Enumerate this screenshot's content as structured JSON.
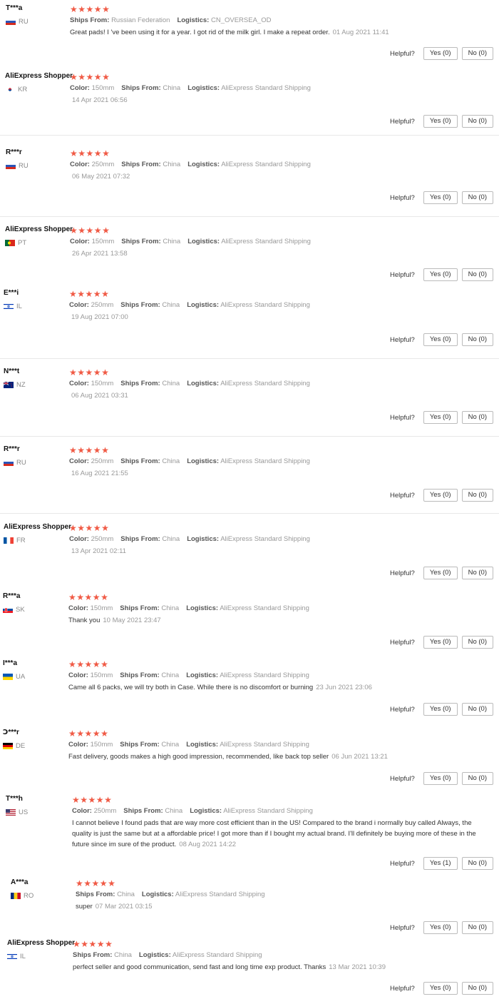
{
  "labels": {
    "color": "Color:",
    "ships_from": "Ships From:",
    "logistics": "Logistics:",
    "helpful": "Helpful?"
  },
  "reviews": [
    {
      "name": "T***a",
      "country": "RU",
      "flag": "ru",
      "rating": 5,
      "ships_from": "Russian Federation",
      "logistics": "CN_OVERSEA_OD",
      "text": "Great pads! I 've been using it for a year. I got rid of the milk girl. I make a repeat order.",
      "date": "01 Aug 2021 11:41",
      "yes": "Yes (0)",
      "no": "No (0)"
    },
    {
      "name": "AliExpress Shopper",
      "country": "KR",
      "flag": "kr",
      "rating": 5,
      "color": "150mm",
      "ships_from": "China",
      "logistics": "AliExpress Standard Shipping",
      "date": "14 Apr 2021 06:56",
      "yes": "Yes (0)",
      "no": "No (0)"
    },
    {
      "name": "R***r",
      "country": "RU",
      "flag": "ru",
      "rating": 5,
      "color": "250mm",
      "ships_from": "China",
      "logistics": "AliExpress Standard Shipping",
      "date": "06 May 2021 07:32",
      "yes": "Yes (0)",
      "no": "No (0)"
    },
    {
      "name": "AliExpress Shopper",
      "country": "PT",
      "flag": "pt",
      "rating": 5,
      "color": "150mm",
      "ships_from": "China",
      "logistics": "AliExpress Standard Shipping",
      "date": "26 Apr 2021 13:58",
      "yes": "Yes (0)",
      "no": "No (0)"
    },
    {
      "name": "E***i",
      "country": "IL",
      "flag": "il",
      "rating": 5,
      "color": "250mm",
      "ships_from": "China",
      "logistics": "AliExpress Standard Shipping",
      "date": "19 Aug 2021 07:00",
      "yes": "Yes (0)",
      "no": "No (0)"
    },
    {
      "name": "N***t",
      "country": "NZ",
      "flag": "nz",
      "rating": 5,
      "color": "150mm",
      "ships_from": "China",
      "logistics": "AliExpress Standard Shipping",
      "date": "06 Aug 2021 03:31",
      "yes": "Yes (0)",
      "no": "No (0)"
    },
    {
      "name": "R***r",
      "country": "RU",
      "flag": "ru",
      "rating": 5,
      "color": "250mm",
      "ships_from": "China",
      "logistics": "AliExpress Standard Shipping",
      "date": "16 Aug 2021 21:55",
      "yes": "Yes (0)",
      "no": "No (0)"
    },
    {
      "name": "AliExpress Shopper",
      "country": "FR",
      "flag": "fr",
      "rating": 5,
      "color": "250mm",
      "ships_from": "China",
      "logistics": "AliExpress Standard Shipping",
      "date": "13 Apr 2021 02:11",
      "yes": "Yes (0)",
      "no": "No (0)"
    },
    {
      "name": "R***a",
      "country": "SK",
      "flag": "sk",
      "rating": 5,
      "color": "150mm",
      "ships_from": "China",
      "logistics": "AliExpress Standard Shipping",
      "text": "Thank you",
      "date": "10 May 2021 23:47",
      "yes": "Yes (0)",
      "no": "No (0)"
    },
    {
      "name": "I***a",
      "country": "UA",
      "flag": "ua",
      "rating": 5,
      "color": "150mm",
      "ships_from": "China",
      "logistics": "AliExpress Standard Shipping",
      "text": "Came all 6 packs, we will try both in Case. While there is no discomfort or burning",
      "date": "23 Jun 2021 23:06",
      "yes": "Yes (0)",
      "no": "No (0)"
    },
    {
      "name": "Ↄ***r",
      "country": "DE",
      "flag": "de",
      "rating": 5,
      "color": "150mm",
      "ships_from": "China",
      "logistics": "AliExpress Standard Shipping",
      "text": "Fast delivery, goods makes a high good impression, recommended, like back top seller",
      "date": "06 Jun 2021 13:21",
      "yes": "Yes (0)",
      "no": "No (0)"
    },
    {
      "name": "T***h",
      "country": "US",
      "flag": "us",
      "rating": 5,
      "color": "250mm",
      "ships_from": "China",
      "logistics": "AliExpress Standard Shipping",
      "text": "I cannot believe I found pads that are way more cost efficient than in the US! Compared to the brand i normally buy called Always, the quality is just the same but at a affordable price! I got more than if I bought my actual brand. I'll definitely be buying more of these in the future since im sure of the product.",
      "date": "08 Aug 2021 14:22",
      "yes": "Yes (1)",
      "no": "No (0)"
    },
    {
      "name": "A***a",
      "country": "RO",
      "flag": "ro",
      "rating": 5,
      "ships_from": "China",
      "logistics": "AliExpress Standard Shipping",
      "text": "super",
      "date": "07 Mar 2021 03:15",
      "yes": "Yes (0)",
      "no": "No (0)"
    },
    {
      "name": "AliExpress Shopper",
      "country": "IL",
      "flag": "il",
      "rating": 5,
      "ships_from": "China",
      "logistics": "AliExpress Standard Shipping",
      "text": "perfect seller and good communication, send fast and long time exp product. Thanks",
      "date": "13 Mar 2021 10:39",
      "yes": "Yes (0)",
      "no": "No (0)"
    }
  ]
}
